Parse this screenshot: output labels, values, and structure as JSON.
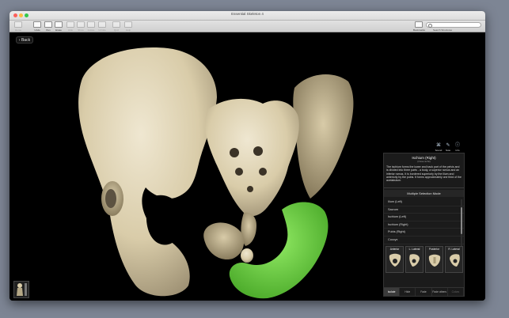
{
  "window": {
    "title": "Essential Skeleton 4"
  },
  "toolbar": {
    "buttons": [
      {
        "label": "Home",
        "enabled": false
      },
      {
        "label": "Undo",
        "enabled": true
      },
      {
        "label": "Pen",
        "enabled": true
      },
      {
        "label": "Erase",
        "enabled": true
      },
      {
        "label": "Hide",
        "enabled": false
      },
      {
        "label": "Show",
        "enabled": false
      },
      {
        "label": "Isolate",
        "enabled": false
      },
      {
        "label": "Unhide",
        "enabled": false
      },
      {
        "label": "Quiz",
        "enabled": false
      },
      {
        "label": "Help",
        "enabled": false
      }
    ],
    "bookmarks_label": "Bookmarks",
    "search_placeholder": "",
    "search_label": "Search Structures"
  },
  "back_button": {
    "label": "Back"
  },
  "panel_icons": [
    {
      "name": "Sound",
      "glyph": "⌘"
    },
    {
      "name": "Note",
      "glyph": "✎"
    },
    {
      "name": "Info",
      "glyph": "ⓘ"
    }
  ],
  "info": {
    "title": "Ischium (Right)",
    "subtitle": "(Ossa ischii)",
    "body": "The ischium forms the lower and back part of the pelvis and is divided into three parts - a body, a superior ramus and an inferior ramus. It is bordered superiorly by the ilium and anteriorly by the pubis. It forms approximately one third of the acetabulum."
  },
  "multiple_selection": {
    "header": "Multiple Selection Mode",
    "items": [
      "Ilium (Left)",
      "Sacrum",
      "Ischium (Left)",
      "Ischium (Right)",
      "Pubis (Right)",
      "Coccyx"
    ]
  },
  "views": [
    "Anterior",
    "L. Lateral",
    "Posterior",
    "R. Lateral"
  ],
  "modes": [
    {
      "label": "Isolate",
      "state": "active"
    },
    {
      "label": "Hide",
      "state": "normal"
    },
    {
      "label": "Fade",
      "state": "normal"
    },
    {
      "label": "Fade others",
      "state": "normal"
    },
    {
      "label": "Colors",
      "state": "dim"
    }
  ],
  "colors": {
    "bone": "#e6dbc0",
    "highlight": "#86ec55",
    "viewport_bg": "#000000"
  }
}
